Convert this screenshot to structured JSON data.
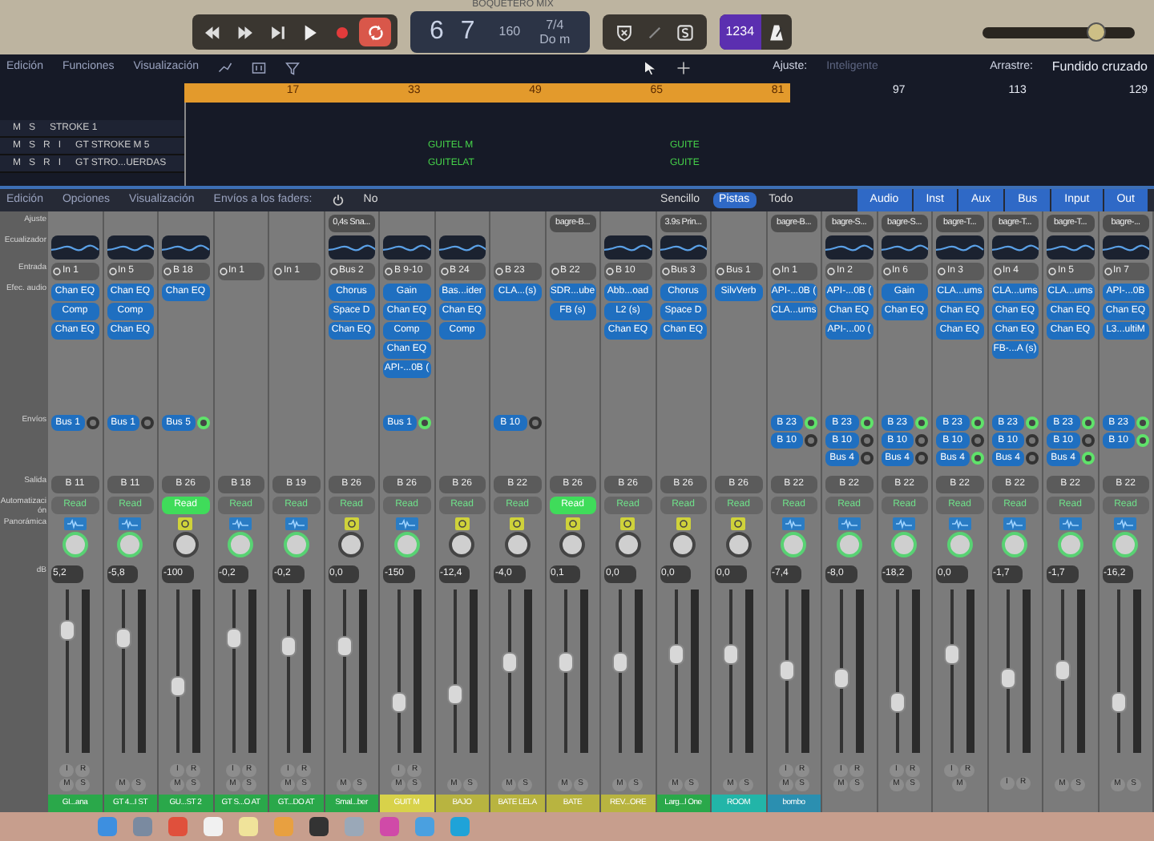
{
  "transport": {
    "title": "BOQUETERO MIX",
    "cycle_on": true,
    "lcd": {
      "position": "6 7",
      "tempo": "160",
      "signature": "7/4",
      "key": "Do m"
    },
    "count_in": "1234",
    "level": 0.75
  },
  "edit_bar": {
    "menus": [
      "Edición",
      "Funciones",
      "Visualización"
    ],
    "snap_label": "Ajuste:",
    "snap_value": "Inteligente",
    "drag_label": "Arrastre:",
    "drag_value": "Fundido cruzado"
  },
  "ruler": [
    {
      "label": "17",
      "in_cycle": true
    },
    {
      "label": "33",
      "in_cycle": true
    },
    {
      "label": "49",
      "in_cycle": true
    },
    {
      "label": "65",
      "in_cycle": true
    },
    {
      "label": "81",
      "in_cycle": true
    },
    {
      "label": "97",
      "in_cycle": false
    },
    {
      "label": "113",
      "in_cycle": false
    },
    {
      "label": "129",
      "in_cycle": false
    }
  ],
  "tracks": [
    {
      "buttons": [
        "M",
        "S"
      ],
      "name": "STROKE 1"
    },
    {
      "buttons": [
        "M",
        "S",
        "R",
        "I"
      ],
      "name": "GT STROKE M 5",
      "regions": [
        "GUITEL M",
        "GUITE"
      ]
    },
    {
      "buttons": [
        "M",
        "S",
        "R",
        "I"
      ],
      "name": "GT STRO...UERDAS",
      "regions": [
        "GUITELAT",
        "GUITE"
      ]
    }
  ],
  "mixer_bar": {
    "menus": [
      "Edición",
      "Opciones",
      "Visualización"
    ],
    "sends_label": "Envíos a los faders:",
    "sends_value": "No",
    "views": [
      {
        "label": "Sencillo",
        "selected": false
      },
      {
        "label": "Pistas",
        "selected": true
      },
      {
        "label": "Todo",
        "selected": false
      }
    ],
    "filters": [
      {
        "label": "Audio",
        "selected": true
      },
      {
        "label": "Inst",
        "selected": true
      },
      {
        "label": "Aux",
        "selected": true
      },
      {
        "label": "Bus",
        "selected": true
      },
      {
        "label": "Input",
        "selected": true
      },
      {
        "label": "Out",
        "selected": true
      }
    ]
  },
  "row_labels": {
    "setting": "Ajuste",
    "eq": "Ecualizador",
    "input": "Entrada",
    "inserts": "Efec. audio",
    "sends": "Envíos",
    "output": "Salida",
    "automation": "Automatización",
    "pan": "Panorámica",
    "volume": "dB"
  },
  "strips": [
    {
      "kind": "audio",
      "eq": true,
      "input": "In 1",
      "inserts": [
        "Chan EQ",
        "Comp",
        "Chan EQ"
      ],
      "sends": [
        {
          "label": "Bus 1",
          "on": false
        }
      ],
      "output": "B 11",
      "automation": {
        "label": "Read",
        "highlighted": false
      },
      "volume": "5,2",
      "level": 0.75,
      "buttons": [
        "M",
        "S"
      ],
      "input_buttons": [
        "I",
        "R"
      ],
      "name": "GI...ana",
      "color": "#2aa84a"
    },
    {
      "kind": "audio",
      "eq": true,
      "input": "In 5",
      "inserts": [
        "Chan EQ",
        "Comp",
        "Chan EQ"
      ],
      "sends": [
        {
          "label": "Bus 1",
          "on": false
        }
      ],
      "output": "B 11",
      "automation": {
        "label": "Read",
        "highlighted": false
      },
      "volume": "-5,8",
      "level": 0.7,
      "buttons": [
        "M",
        "S"
      ],
      "name": "GT 4...I ST",
      "color": "#2aa84a"
    },
    {
      "kind": "aux",
      "eq": true,
      "input": "B 18",
      "inserts": [
        "Chan EQ"
      ],
      "sends": [
        {
          "label": "Bus 5",
          "on": true
        }
      ],
      "output": "B 26",
      "automation": {
        "label": "Read",
        "highlighted": true
      },
      "volume": "-100",
      "level": 0.4,
      "buttons": [
        "M",
        "S"
      ],
      "input_buttons": [
        "I",
        "R"
      ],
      "name": "GU...ST 2",
      "color": "#2aa84a"
    },
    {
      "kind": "audio",
      "eq": false,
      "input": "In 1",
      "output": "B 18",
      "automation": {
        "label": "Read",
        "highlighted": false
      },
      "volume": "-0,2",
      "level": 0.7,
      "buttons": [
        "M",
        "S"
      ],
      "input_buttons": [
        "I",
        "R"
      ],
      "name": "GT S...O AT",
      "color": "#2aa84a"
    },
    {
      "kind": "audio",
      "eq": false,
      "input": "In 1",
      "output": "B 19",
      "automation": {
        "label": "Read",
        "highlighted": false
      },
      "volume": "-0,2",
      "level": 0.65,
      "buttons": [
        "M",
        "S"
      ],
      "input_buttons": [
        "I",
        "R"
      ],
      "name": "GT...DO AT",
      "color": "#2aa84a"
    },
    {
      "kind": "aux",
      "setting": "0,4s Sna...",
      "eq": true,
      "input": "Bus 2",
      "inserts": [
        "Chorus",
        "Space D",
        "Chan EQ"
      ],
      "output": "B 26",
      "automation": {
        "label": "Read",
        "highlighted": false
      },
      "volume": "0,0",
      "level": 0.65,
      "buttons": [
        "M",
        "S"
      ],
      "name": "Smal...ber",
      "color": "#2aa84a"
    },
    {
      "kind": "audio",
      "eq": true,
      "input": "B 9-10",
      "inserts": [
        "Gain",
        "Chan EQ",
        "Comp",
        "Chan EQ",
        "API-...0B ("
      ],
      "sends": [
        {
          "label": "Bus 1",
          "on": true
        }
      ],
      "output": "B 26",
      "automation": {
        "label": "Read",
        "highlighted": false
      },
      "volume": "-150",
      "level": 0.3,
      "buttons": [
        "M",
        "S"
      ],
      "input_buttons": [
        "I",
        "R"
      ],
      "name": "GUIT M",
      "color": "#d8d24a"
    },
    {
      "kind": "aux",
      "eq": true,
      "input": "B 24",
      "inserts": [
        "Bas...ider",
        "Chan EQ",
        "Comp"
      ],
      "output": "B 26",
      "automation": {
        "label": "Read",
        "highlighted": false
      },
      "volume": "-12,4",
      "level": 0.35,
      "buttons": [
        "M",
        "S"
      ],
      "name": "BAJO",
      "color": "#b8b440"
    },
    {
      "kind": "aux",
      "eq": false,
      "input": "B 23",
      "inserts": [
        "CLA...(s)"
      ],
      "sends": [
        {
          "label": "B 10",
          "on": false
        }
      ],
      "output": "B 22",
      "automation": {
        "label": "Read",
        "highlighted": false
      },
      "volume": "-4,0",
      "level": 0.55,
      "buttons": [
        "M",
        "S"
      ],
      "name": "BATE LELA",
      "color": "#b8b440"
    },
    {
      "kind": "aux",
      "setting": "bagre-B...",
      "eq": false,
      "input": "B 22",
      "inserts": [
        "SDR...ube",
        "FB (s)"
      ],
      "output": "B 26",
      "automation": {
        "label": "Read",
        "highlighted": true
      },
      "volume": "0,1",
      "level": 0.55,
      "buttons": [
        "M",
        "S"
      ],
      "name": "BATE",
      "color": "#b8b440"
    },
    {
      "kind": "aux",
      "eq": true,
      "input": "B 10",
      "inserts": [
        "Abb...oad",
        "L2 (s)",
        "Chan EQ"
      ],
      "output": "B 26",
      "automation": {
        "label": "Read",
        "highlighted": false
      },
      "volume": "0,0",
      "level": 0.55,
      "buttons": [
        "M",
        "S"
      ],
      "name": "REV...ORE",
      "color": "#b8b440"
    },
    {
      "kind": "aux",
      "setting": "3.9s Prin...",
      "eq": true,
      "input": "Bus 3",
      "inserts": [
        "Chorus",
        "Space D",
        "Chan EQ"
      ],
      "output": "B 26",
      "automation": {
        "label": "Read",
        "highlighted": false
      },
      "volume": "0,0",
      "level": 0.6,
      "buttons": [
        "M",
        "S"
      ],
      "name": "Larg...l One",
      "color": "#2aa84a"
    },
    {
      "kind": "aux",
      "eq": false,
      "input": "Bus 1",
      "inserts": [
        "SilvVerb"
      ],
      "output": "B 26",
      "automation": {
        "label": "Read",
        "highlighted": false
      },
      "volume": "0,0",
      "level": 0.6,
      "buttons": [
        "M",
        "S"
      ],
      "name": "ROOM",
      "color": "#22b5a8"
    },
    {
      "kind": "audio",
      "setting": "bagre-B...",
      "eq": false,
      "input": "In 1",
      "inserts": [
        "API-...0B (",
        "CLA...ums"
      ],
      "sends": [
        {
          "label": "B 23",
          "on": true
        },
        {
          "label": "B 10",
          "on": false
        }
      ],
      "output": "B 22",
      "automation": {
        "label": "Read",
        "highlighted": false
      },
      "volume": "-7,4",
      "level": 0.5,
      "buttons": [
        "M",
        "S"
      ],
      "input_buttons": [
        "I",
        "R"
      ],
      "name": "bombo",
      "color": "#2b8fb0"
    },
    {
      "kind": "audio",
      "setting": "bagre-S...",
      "eq": true,
      "input": "In 2",
      "inserts": [
        "API-...0B (",
        "Chan EQ",
        "API-...00 ("
      ],
      "sends": [
        {
          "label": "B 23",
          "on": true
        },
        {
          "label": "B 10",
          "on": false
        },
        {
          "label": "Bus 4",
          "on": false
        }
      ],
      "output": "B 22",
      "automation": {
        "label": "Read",
        "highlighted": false
      },
      "volume": "-8,0",
      "level": 0.45,
      "buttons": [
        "M",
        "S"
      ],
      "input_buttons": [
        "I",
        "R"
      ]
    },
    {
      "kind": "audio",
      "setting": "bagre-S...",
      "eq": true,
      "input": "In 6",
      "inserts": [
        "Gain",
        "Chan EQ"
      ],
      "sends": [
        {
          "label": "B 23",
          "on": true
        },
        {
          "label": "B 10",
          "on": false
        },
        {
          "label": "Bus 4",
          "on": false
        }
      ],
      "output": "B 22",
      "automation": {
        "label": "Read",
        "highlighted": false
      },
      "volume": "-18,2",
      "level": 0.3,
      "buttons": [
        "M",
        "S"
      ],
      "input_buttons": [
        "I",
        "R"
      ]
    },
    {
      "kind": "audio",
      "setting": "bagre-T...",
      "eq": true,
      "input": "In 3",
      "inserts": [
        "CLA...ums",
        "Chan EQ",
        "Chan EQ"
      ],
      "sends": [
        {
          "label": "B 23",
          "on": true
        },
        {
          "label": "B 10",
          "on": false
        },
        {
          "label": "Bus 4",
          "on": true
        }
      ],
      "output": "B 22",
      "automation": {
        "label": "Read",
        "highlighted": false
      },
      "volume": "0,0",
      "level": 0.6,
      "buttons": [
        "M"
      ],
      "input_buttons": [
        "I",
        "R"
      ]
    },
    {
      "kind": "audio",
      "setting": "bagre-T...",
      "eq": true,
      "input": "In 4",
      "inserts": [
        "CLA...ums",
        "Chan EQ",
        "Chan EQ",
        "FB-...A (s)"
      ],
      "sends": [
        {
          "label": "B 23",
          "on": true
        },
        {
          "label": "B 10",
          "on": false
        },
        {
          "label": "Bus 4",
          "on": false
        }
      ],
      "output": "B 22",
      "automation": {
        "label": "Read",
        "highlighted": false
      },
      "volume": "-1,7",
      "level": 0.45,
      "input_buttons": [
        "I",
        "R"
      ]
    },
    {
      "kind": "audio",
      "setting": "bagre-T...",
      "eq": true,
      "input": "In 5",
      "inserts": [
        "CLA...ums",
        "Chan EQ",
        "Chan EQ"
      ],
      "sends": [
        {
          "label": "B 23",
          "on": true
        },
        {
          "label": "B 10",
          "on": false
        },
        {
          "label": "Bus 4",
          "on": true
        }
      ],
      "output": "B 22",
      "automation": {
        "label": "Read",
        "highlighted": false
      },
      "volume": "-1,7",
      "level": 0.5,
      "buttons": [
        "M",
        "S"
      ]
    },
    {
      "kind": "audio",
      "setting": "bagre-...",
      "eq": true,
      "input": "In 7",
      "inserts": [
        "API-...0B",
        "Chan EQ",
        "L3...ultiM"
      ],
      "sends": [
        {
          "label": "B 23",
          "on": true
        },
        {
          "label": "B 10",
          "on": true
        }
      ],
      "output": "B 22",
      "automation": {
        "label": "Read",
        "highlighted": false
      },
      "volume": "-16,2",
      "level": 0.3,
      "buttons": [
        "M",
        "S"
      ]
    }
  ]
}
